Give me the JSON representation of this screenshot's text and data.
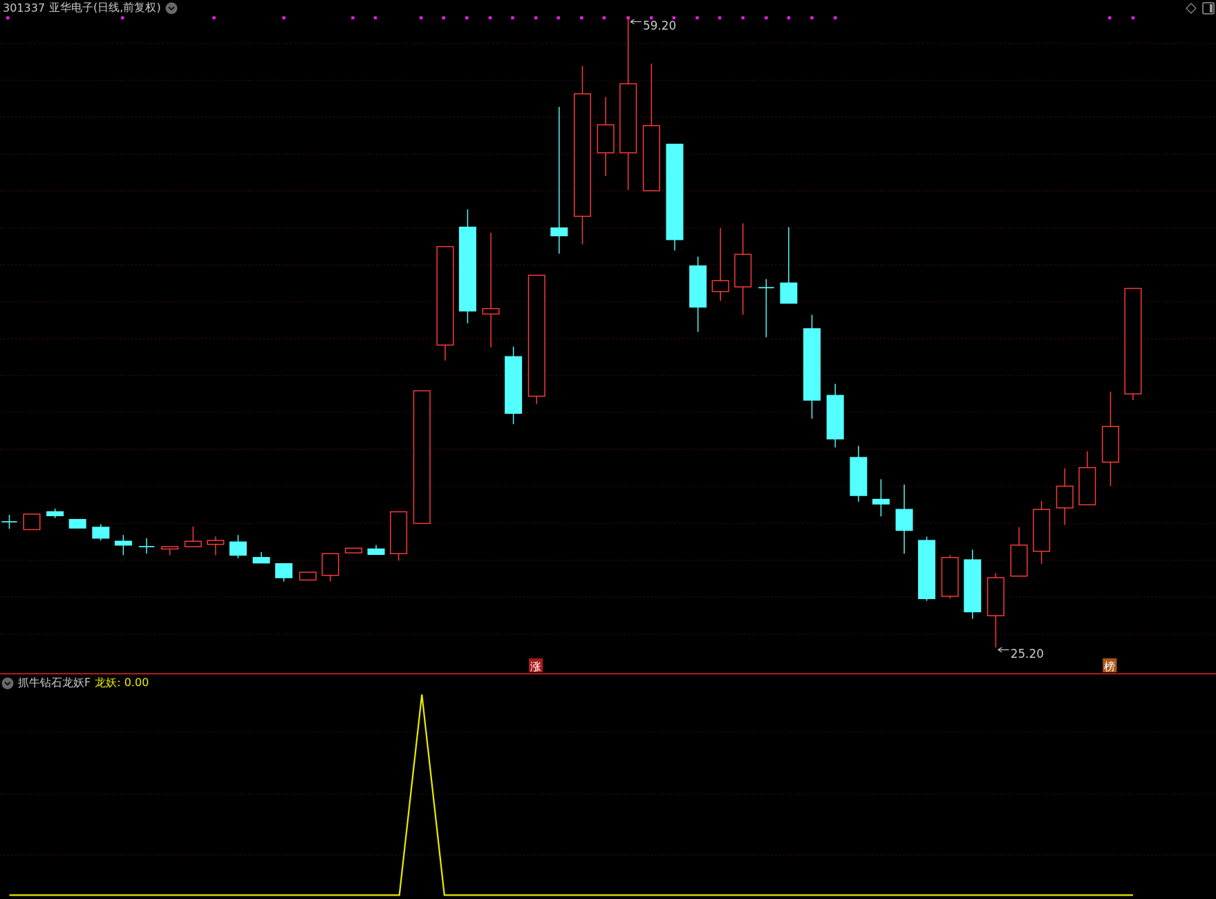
{
  "header": {
    "symbol": "301337",
    "name": "亚华电子(日线,前复权)"
  },
  "price_marks": [
    {
      "kind": "high",
      "label": "59.20"
    },
    {
      "kind": "low",
      "label": "25.20"
    }
  ],
  "tags": [
    {
      "label": "涨",
      "color": "#a81c1c"
    },
    {
      "label": "榜",
      "color": "#a8581c"
    }
  ],
  "indicator": {
    "title": "抓牛钻石龙妖F",
    "value_label": "龙妖: 0.00"
  }
}
